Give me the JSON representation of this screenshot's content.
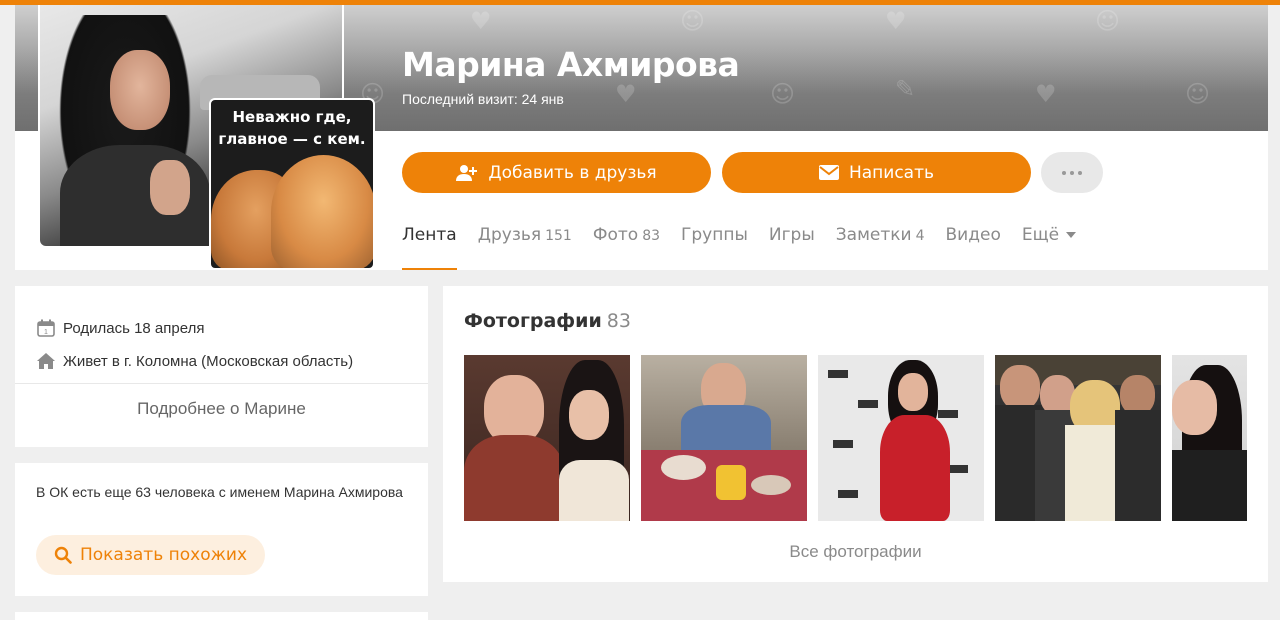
{
  "profile": {
    "name": "Марина Ахмирова",
    "last_visit": "Последний визит: 24 янв",
    "avatar_caption": "Неважно где,\nглавное — с кем."
  },
  "actions": {
    "add_friend": "Добавить в друзья",
    "write": "Написать",
    "more_icon": "more-dots-icon"
  },
  "tabs": [
    {
      "label": "Лента",
      "count": "",
      "active": true
    },
    {
      "label": "Друзья",
      "count": "151"
    },
    {
      "label": "Фото",
      "count": "83"
    },
    {
      "label": "Группы",
      "count": ""
    },
    {
      "label": "Игры",
      "count": ""
    },
    {
      "label": "Заметки",
      "count": "4"
    },
    {
      "label": "Видео",
      "count": ""
    },
    {
      "label": "Ещё",
      "count": ""
    }
  ],
  "about": {
    "birthday": "Родилась 18 апреля",
    "lives": "Живет в г. Коломна (Московская область)",
    "more": "Подробнее о Марине"
  },
  "same_name": {
    "text": "В ОК есть еще 63 человека с именем Марина Ахмирова",
    "button": "Показать похожих"
  },
  "photos": {
    "title": "Фотографии",
    "count": "83",
    "all": "Все фотографии"
  },
  "colors": {
    "accent": "#ee8208",
    "accent_light": "#fdefdf",
    "background": "#efefef"
  }
}
